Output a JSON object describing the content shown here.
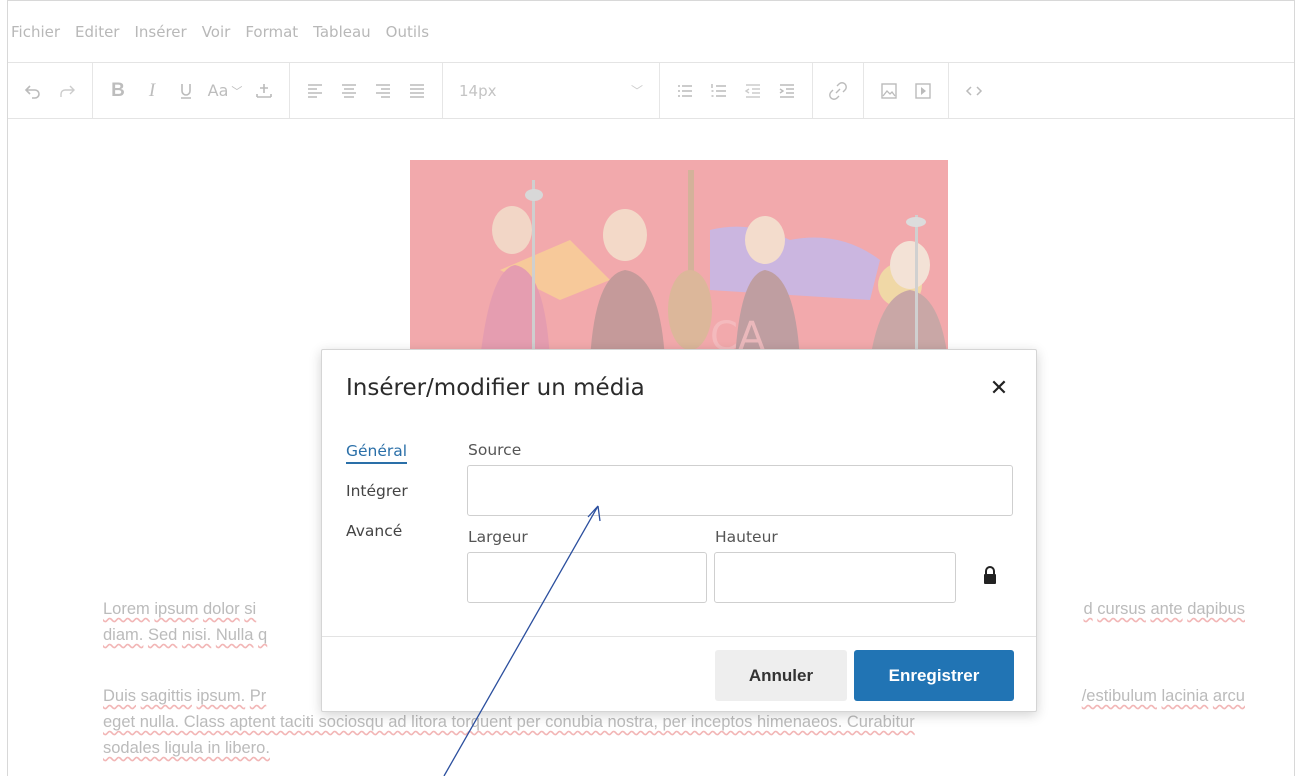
{
  "menubar": {
    "items": [
      "Fichier",
      "Editer",
      "Insérer",
      "Voir",
      "Format",
      "Tableau",
      "Outils"
    ]
  },
  "toolbar": {
    "font_size": "14px",
    "icons": [
      "undo-icon",
      "redo-icon",
      "bold-icon",
      "italic-icon",
      "underline-icon",
      "font-case-icon",
      "insert-icon",
      "align-left-icon",
      "align-center-icon",
      "align-right-icon",
      "align-justify-icon",
      "bullet-list-icon",
      "numbered-list-icon",
      "outdent-icon",
      "indent-icon",
      "link-icon",
      "image-icon",
      "media-icon",
      "code-icon"
    ]
  },
  "content": {
    "paragraph1_left": [
      "Lorem",
      "ipsum",
      "dolor",
      "si"
    ],
    "paragraph1_left2": [
      "diam.",
      "Sed",
      "nisi.",
      "Nulla",
      "q"
    ],
    "paragraph1_right": [
      "d",
      "cursus",
      "ante",
      "dapibus"
    ],
    "paragraph2": {
      "line1_left": [
        "Duis",
        "sagittis",
        "ipsum.",
        "Pr"
      ],
      "line1_right": [
        "/estibulum",
        "lacinia",
        "arcu"
      ],
      "line2": "eget nulla. Class aptent taciti sociosqu ad litora torquent per conubia nostra, per inceptos himenaeos. Curabitur",
      "line3": "sodales ligula in libero."
    }
  },
  "dialog": {
    "title": "Insérer/modifier un média",
    "close_label": "✕",
    "tabs": [
      "Général",
      "Intégrer",
      "Avancé"
    ],
    "source_label": "Source",
    "source_value": "",
    "width_label": "Largeur",
    "width_value": "",
    "height_label": "Hauteur",
    "height_value": "",
    "cancel_label": "Annuler",
    "save_label": "Enregistrer"
  },
  "colors": {
    "accent": "#2174b4",
    "active_tab": "#2a6fa8",
    "arrow": "#2b4f9e"
  }
}
